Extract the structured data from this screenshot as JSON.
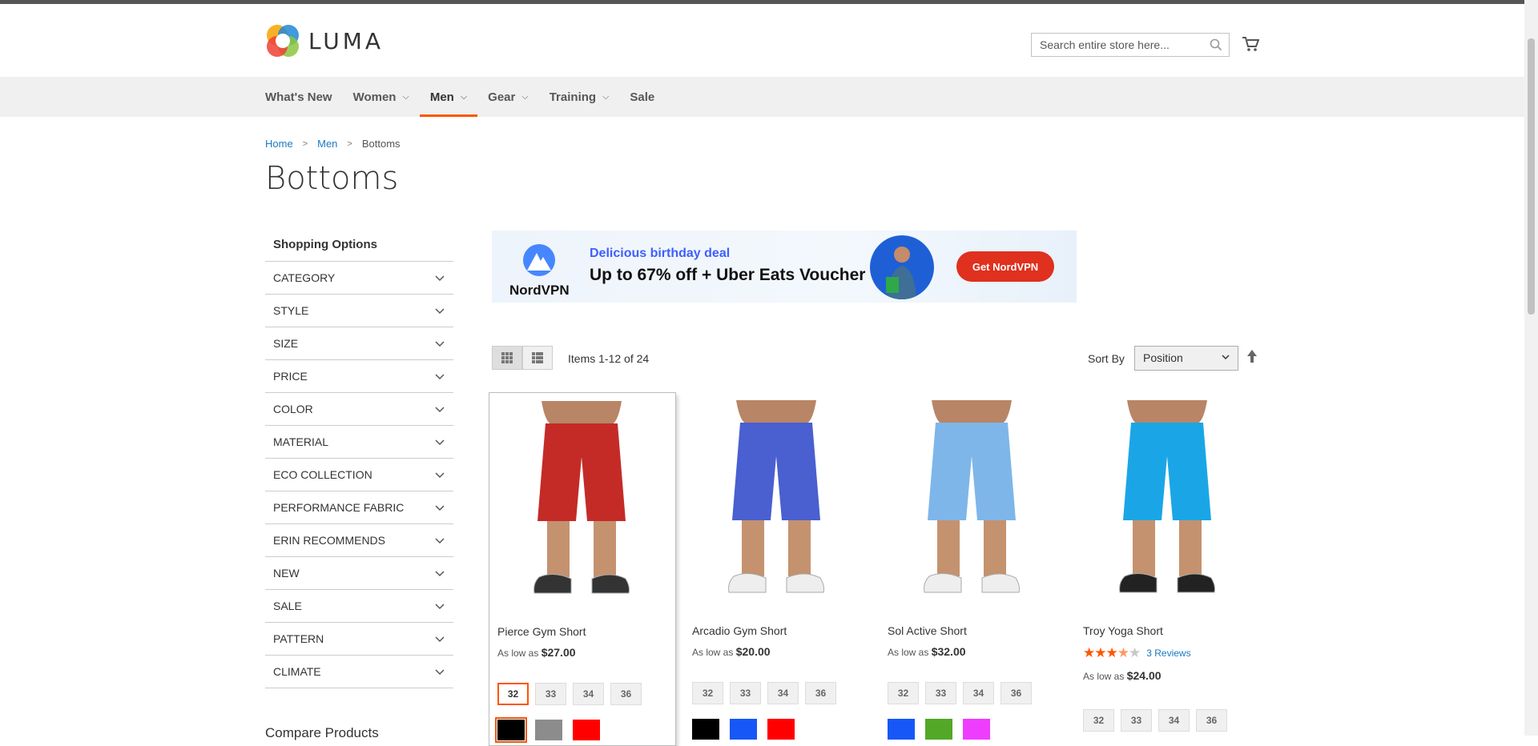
{
  "header": {
    "logo_text": "LUMA",
    "search_placeholder": "Search entire store here...",
    "colors": {
      "accent": "#ff5501",
      "link": "#1979c3"
    }
  },
  "nav": {
    "items": [
      {
        "label": "What's New"
      },
      {
        "label": "Women"
      },
      {
        "label": "Men"
      },
      {
        "label": "Gear"
      },
      {
        "label": "Training"
      },
      {
        "label": "Sale"
      }
    ],
    "active": "Men"
  },
  "breadcrumb": {
    "home": "Home",
    "men": "Men",
    "current": "Bottoms"
  },
  "page_title": "Bottoms",
  "sidebar": {
    "title": "Shopping Options",
    "filters": [
      "CATEGORY",
      "STYLE",
      "SIZE",
      "PRICE",
      "COLOR",
      "MATERIAL",
      "ECO COLLECTION",
      "PERFORMANCE FABRIC",
      "ERIN RECOMMENDS",
      "NEW",
      "SALE",
      "PATTERN",
      "CLIMATE"
    ],
    "compare_title": "Compare Products"
  },
  "ad": {
    "brand": "NordVPN",
    "subtitle": "Delicious birthday deal",
    "headline": "Up to 67% off + Uber Eats Voucher",
    "button": "Get NordVPN"
  },
  "toolbar": {
    "items_count": "Items 1-12 of 24",
    "sort_label": "Sort By",
    "sort_value": "Position"
  },
  "products": [
    {
      "name": "Pierce Gym Short",
      "price_prefix": "As low as",
      "price": "$27.00",
      "sizes": [
        "32",
        "33",
        "34",
        "36"
      ],
      "colors": [
        "#000000",
        "#8c8c8c",
        "#ff0000"
      ],
      "short_color": "#c42b27",
      "rating": null,
      "reviews": null
    },
    {
      "name": "Arcadio Gym Short",
      "price_prefix": "As low as",
      "price": "$20.00",
      "sizes": [
        "32",
        "33",
        "34",
        "36"
      ],
      "colors": [
        "#000000",
        "#1857f7",
        "#ff0000"
      ],
      "short_color": "#4a5fd0",
      "rating": null,
      "reviews": null
    },
    {
      "name": "Sol Active Short",
      "price_prefix": "As low as",
      "price": "$32.00",
      "sizes": [
        "32",
        "33",
        "34",
        "36"
      ],
      "colors": [
        "#1857f7",
        "#53a828",
        "#ef3dff"
      ],
      "short_color": "#7eb6ea",
      "rating": null,
      "reviews": null
    },
    {
      "name": "Troy Yoga Short",
      "price_prefix": "As low as",
      "price": "$24.00",
      "sizes": [
        "32",
        "33",
        "34",
        "36"
      ],
      "colors": [],
      "short_color": "#1aa6e6",
      "rating": 3.5,
      "reviews": "3 Reviews"
    }
  ]
}
